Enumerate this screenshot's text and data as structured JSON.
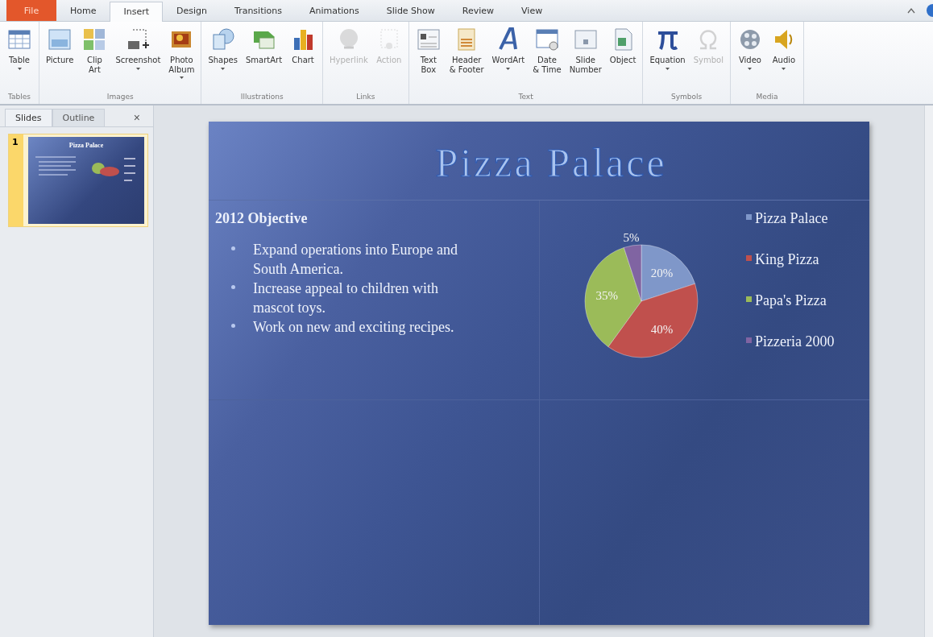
{
  "ribbon_tabs": [
    {
      "label": "File",
      "kind": "file",
      "selected": false
    },
    {
      "label": "Home",
      "kind": "tab",
      "selected": false
    },
    {
      "label": "Insert",
      "kind": "tab",
      "selected": true
    },
    {
      "label": "Design",
      "kind": "tab",
      "selected": false
    },
    {
      "label": "Transitions",
      "kind": "tab",
      "selected": false
    },
    {
      "label": "Animations",
      "kind": "tab",
      "selected": false
    },
    {
      "label": "Slide Show",
      "kind": "tab",
      "selected": false
    },
    {
      "label": "Review",
      "kind": "tab",
      "selected": false
    },
    {
      "label": "View",
      "kind": "tab",
      "selected": false
    }
  ],
  "ribbon_groups": [
    {
      "label": "Tables",
      "buttons": [
        {
          "label": "Table",
          "dropdown": true,
          "disabled": false
        }
      ]
    },
    {
      "label": "Images",
      "buttons": [
        {
          "label": "Picture",
          "dropdown": false,
          "disabled": false
        },
        {
          "label": "Clip\nArt",
          "dropdown": false,
          "disabled": false
        },
        {
          "label": "Screenshot",
          "dropdown": true,
          "disabled": false
        },
        {
          "label": "Photo\nAlbum",
          "dropdown": true,
          "disabled": false
        }
      ]
    },
    {
      "label": "Illustrations",
      "buttons": [
        {
          "label": "Shapes",
          "dropdown": true,
          "disabled": false
        },
        {
          "label": "SmartArt",
          "dropdown": false,
          "disabled": false
        },
        {
          "label": "Chart",
          "dropdown": false,
          "disabled": false
        }
      ]
    },
    {
      "label": "Links",
      "buttons": [
        {
          "label": "Hyperlink",
          "dropdown": false,
          "disabled": true
        },
        {
          "label": "Action",
          "dropdown": false,
          "disabled": true
        }
      ]
    },
    {
      "label": "Text",
      "buttons": [
        {
          "label": "Text\nBox",
          "dropdown": false,
          "disabled": false
        },
        {
          "label": "Header\n& Footer",
          "dropdown": false,
          "disabled": false
        },
        {
          "label": "WordArt",
          "dropdown": true,
          "disabled": false
        },
        {
          "label": "Date\n& Time",
          "dropdown": false,
          "disabled": false
        },
        {
          "label": "Slide\nNumber",
          "dropdown": false,
          "disabled": false
        },
        {
          "label": "Object",
          "dropdown": false,
          "disabled": false
        }
      ]
    },
    {
      "label": "Symbols",
      "buttons": [
        {
          "label": "Equation",
          "dropdown": true,
          "disabled": false
        },
        {
          "label": "Symbol",
          "dropdown": false,
          "disabled": true
        }
      ]
    },
    {
      "label": "Media",
      "buttons": [
        {
          "label": "Video",
          "dropdown": true,
          "disabled": false
        },
        {
          "label": "Audio",
          "dropdown": true,
          "disabled": false
        }
      ]
    }
  ],
  "panel_tabs": [
    {
      "label": "Slides",
      "selected": true
    },
    {
      "label": "Outline",
      "selected": false
    }
  ],
  "panel_close": "×",
  "thumbnails": [
    {
      "number": "1",
      "title": "Pizza Palace",
      "selected": true
    }
  ],
  "slide": {
    "title": "Pizza Palace",
    "heading": "2012 Objective",
    "bullets": [
      "Expand operations into Europe and South America.",
      "Increase appeal to children with mascot toys.",
      "Work on new and exciting recipes."
    ],
    "legend": [
      {
        "color": "#7f97c9"
      },
      {
        "color": "#c0504d"
      },
      {
        "color": "#9bbb59"
      },
      {
        "color": "#8064a2"
      }
    ],
    "chart_data": {
      "type": "pie",
      "categories": [
        "Pizza Palace",
        "King Pizza",
        "Papa's Pizza",
        "Pizzeria 2000"
      ],
      "values": [
        20,
        40,
        35,
        5
      ],
      "value_labels": [
        "20%",
        "40%",
        "35%",
        "5%"
      ]
    }
  }
}
